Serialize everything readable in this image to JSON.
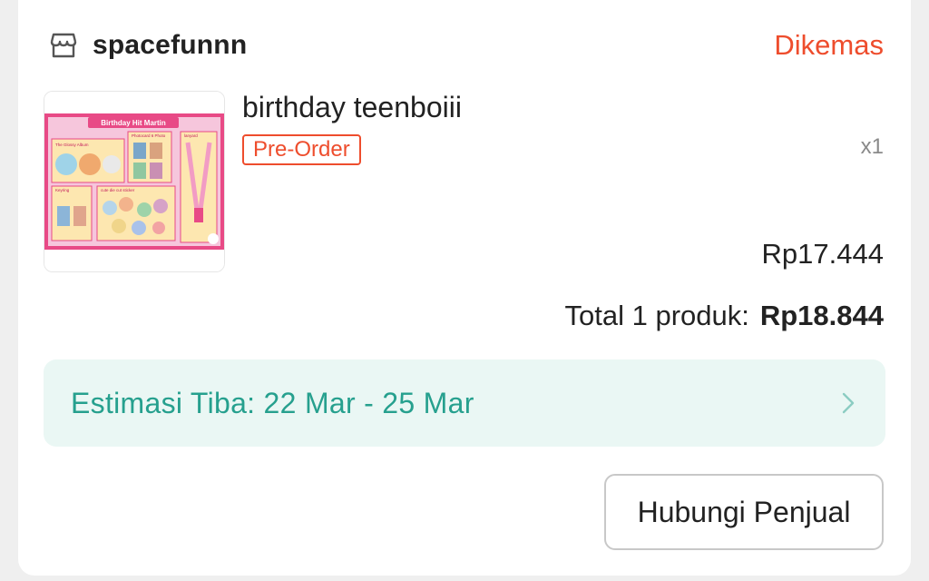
{
  "shop": {
    "name": "spacefunnn",
    "icon": "store-icon"
  },
  "order": {
    "status": "Dikemas",
    "status_color": "#ee4d2d"
  },
  "product": {
    "title": "birthday teenboiii",
    "badge": "Pre-Order",
    "quantity": "x1",
    "price": "Rp17.444",
    "thumbnail": {
      "icon": "product-image",
      "banner": "Birthday Hit Martin",
      "labels": {
        "album": "The Glossy Album",
        "photocard": "Photocard 6 Photo",
        "lanyard": "lanyard",
        "keyring": "Keyring",
        "stickers": "cute die cut sticker"
      }
    }
  },
  "summary": {
    "label": "Total 1 produk:",
    "value": "Rp18.844"
  },
  "delivery": {
    "eta_text": "Estimasi Tiba: 22 Mar - 25 Mar",
    "accent": "#26a08e",
    "icon": "chevron-right-icon"
  },
  "actions": {
    "contact_seller": "Hubungi Penjual"
  }
}
